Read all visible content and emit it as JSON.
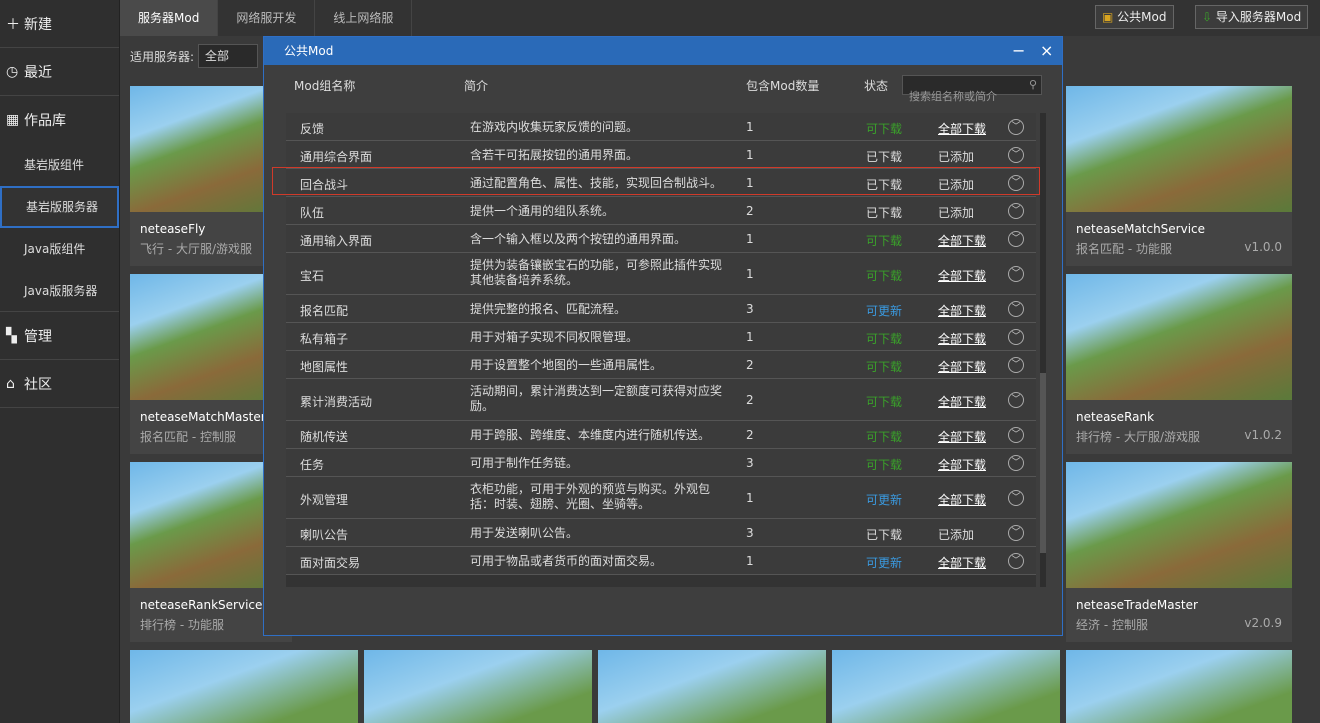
{
  "sidebar": {
    "new": "新建",
    "recent": "最近",
    "works": "作品库",
    "bed_comp": "基岩版组件",
    "bed_srv": "基岩版服务器",
    "java_comp": "Java版组件",
    "java_srv": "Java版服务器",
    "manage": "管理",
    "community": "社区"
  },
  "tabs": [
    "服务器Mod",
    "网络服开发",
    "线上网络服"
  ],
  "buttons": {
    "public": "公共Mod",
    "import": "导入服务器Mod"
  },
  "filter": {
    "label": "适用服务器:",
    "value": "全部"
  },
  "cards": [
    {
      "title": "neteaseFly",
      "sub": "飞行 - 大厅服/游戏服",
      "ver": ""
    },
    {
      "title": "neteaseMatchService",
      "sub": "报名匹配 - 功能服",
      "ver": "v1.0.0"
    },
    {
      "title": "neteaseMatchMaster",
      "sub": "报名匹配 - 控制服",
      "ver": ""
    },
    {
      "title": "neteaseRank",
      "sub": "排行榜 - 大厅服/游戏服",
      "ver": "v1.0.2"
    },
    {
      "title": "neteaseRankService",
      "sub": "排行榜 - 功能服",
      "ver": ""
    },
    {
      "title": "neteaseTradeMaster",
      "sub": "经济 - 控制服",
      "ver": "v2.0.9"
    }
  ],
  "dialog": {
    "title": "公共Mod",
    "min": "−",
    "close": "×",
    "h_name": "Mod组名称",
    "h_desc": "简介",
    "h_count": "包含Mod数量",
    "h_status": "状态",
    "search_ph": "搜索组名称或简介",
    "search_icon": "search-icon",
    "rows": [
      {
        "n": "反馈",
        "d": "在游戏内收集玩家反馈的问题。",
        "q": "1",
        "st": "可下载",
        "ac": "全部下载"
      },
      {
        "n": "通用综合界面",
        "d": "含若干可拓展按钮的通用界面。",
        "q": "1",
        "st": "已下载",
        "ac": "已添加"
      },
      {
        "n": "回合战斗",
        "d": "通过配置角色、属性、技能，实现回合制战斗。",
        "q": "1",
        "st": "已下载",
        "ac": "已添加"
      },
      {
        "n": "队伍",
        "d": "提供一个通用的组队系统。",
        "q": "2",
        "st": "已下载",
        "ac": "已添加"
      },
      {
        "n": "通用输入界面",
        "d": "含一个输入框以及两个按钮的通用界面。",
        "q": "1",
        "st": "可下载",
        "ac": "全部下载"
      },
      {
        "n": "宝石",
        "d": "提供为装备镶嵌宝石的功能，可参照此插件实现其他装备培养系统。",
        "q": "1",
        "st": "可下载",
        "ac": "全部下载"
      },
      {
        "n": "报名匹配",
        "d": "提供完整的报名、匹配流程。",
        "q": "3",
        "st": "可更新",
        "ac": "全部下载"
      },
      {
        "n": "私有箱子",
        "d": "用于对箱子实现不同权限管理。",
        "q": "1",
        "st": "可下载",
        "ac": "全部下载"
      },
      {
        "n": "地图属性",
        "d": "用于设置整个地图的一些通用属性。",
        "q": "2",
        "st": "可下载",
        "ac": "全部下载"
      },
      {
        "n": "累计消费活动",
        "d": "活动期间，累计消费达到一定额度可获得对应奖励。",
        "q": "2",
        "st": "可下载",
        "ac": "全部下载"
      },
      {
        "n": "随机传送",
        "d": "用于跨服、跨维度、本维度内进行随机传送。",
        "q": "2",
        "st": "可下载",
        "ac": "全部下载"
      },
      {
        "n": "任务",
        "d": "可用于制作任务链。",
        "q": "3",
        "st": "可下载",
        "ac": "全部下载"
      },
      {
        "n": "外观管理",
        "d": "衣柜功能，可用于外观的预览与购买。外观包括：时装、翅膀、光圈、坐骑等。",
        "q": "1",
        "st": "可更新",
        "ac": "全部下载"
      },
      {
        "n": "喇叭公告",
        "d": "用于发送喇叭公告。",
        "q": "3",
        "st": "已下载",
        "ac": "已添加"
      },
      {
        "n": "面对面交易",
        "d": "可用于物品或者货币的面对面交易。",
        "q": "1",
        "st": "可更新",
        "ac": "全部下载"
      }
    ]
  }
}
